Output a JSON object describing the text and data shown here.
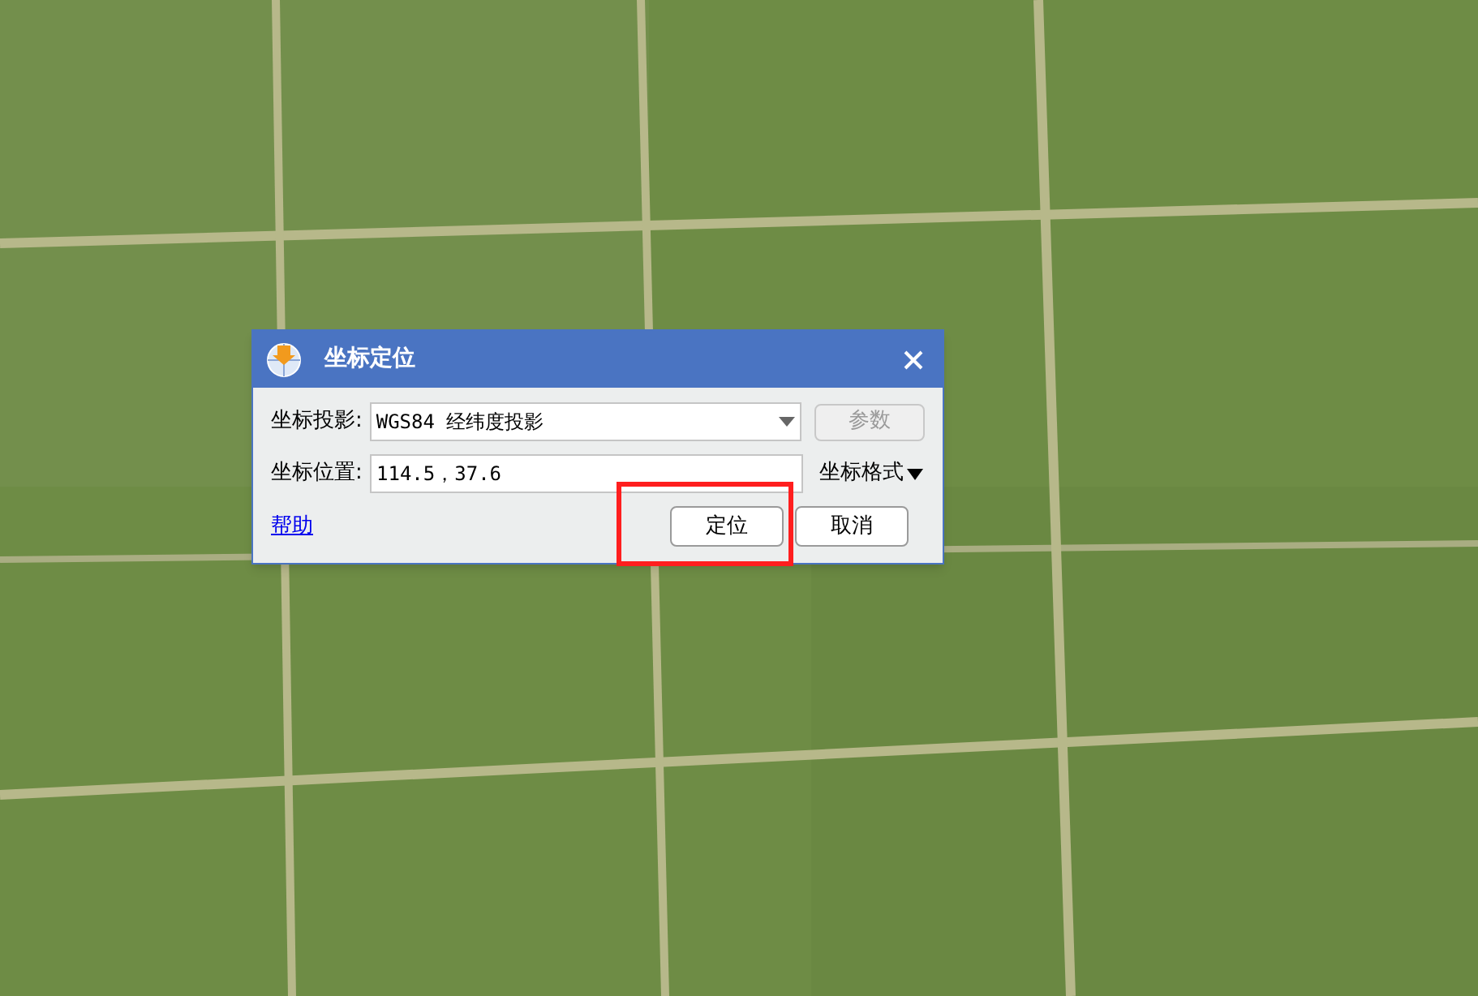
{
  "dialog": {
    "title": "坐标定位",
    "projection": {
      "label": "坐标投影:",
      "value": "WGS84 经纬度投影",
      "button": {
        "label": "参数",
        "disabled": true
      }
    },
    "position": {
      "label": "坐标位置:",
      "value": "114.5，37.6",
      "format_menu": "坐标格式"
    },
    "help_link": "帮助",
    "buttons": [
      {
        "label": "定位",
        "highlighted": true
      },
      {
        "label": "取消",
        "highlighted": false
      }
    ]
  }
}
